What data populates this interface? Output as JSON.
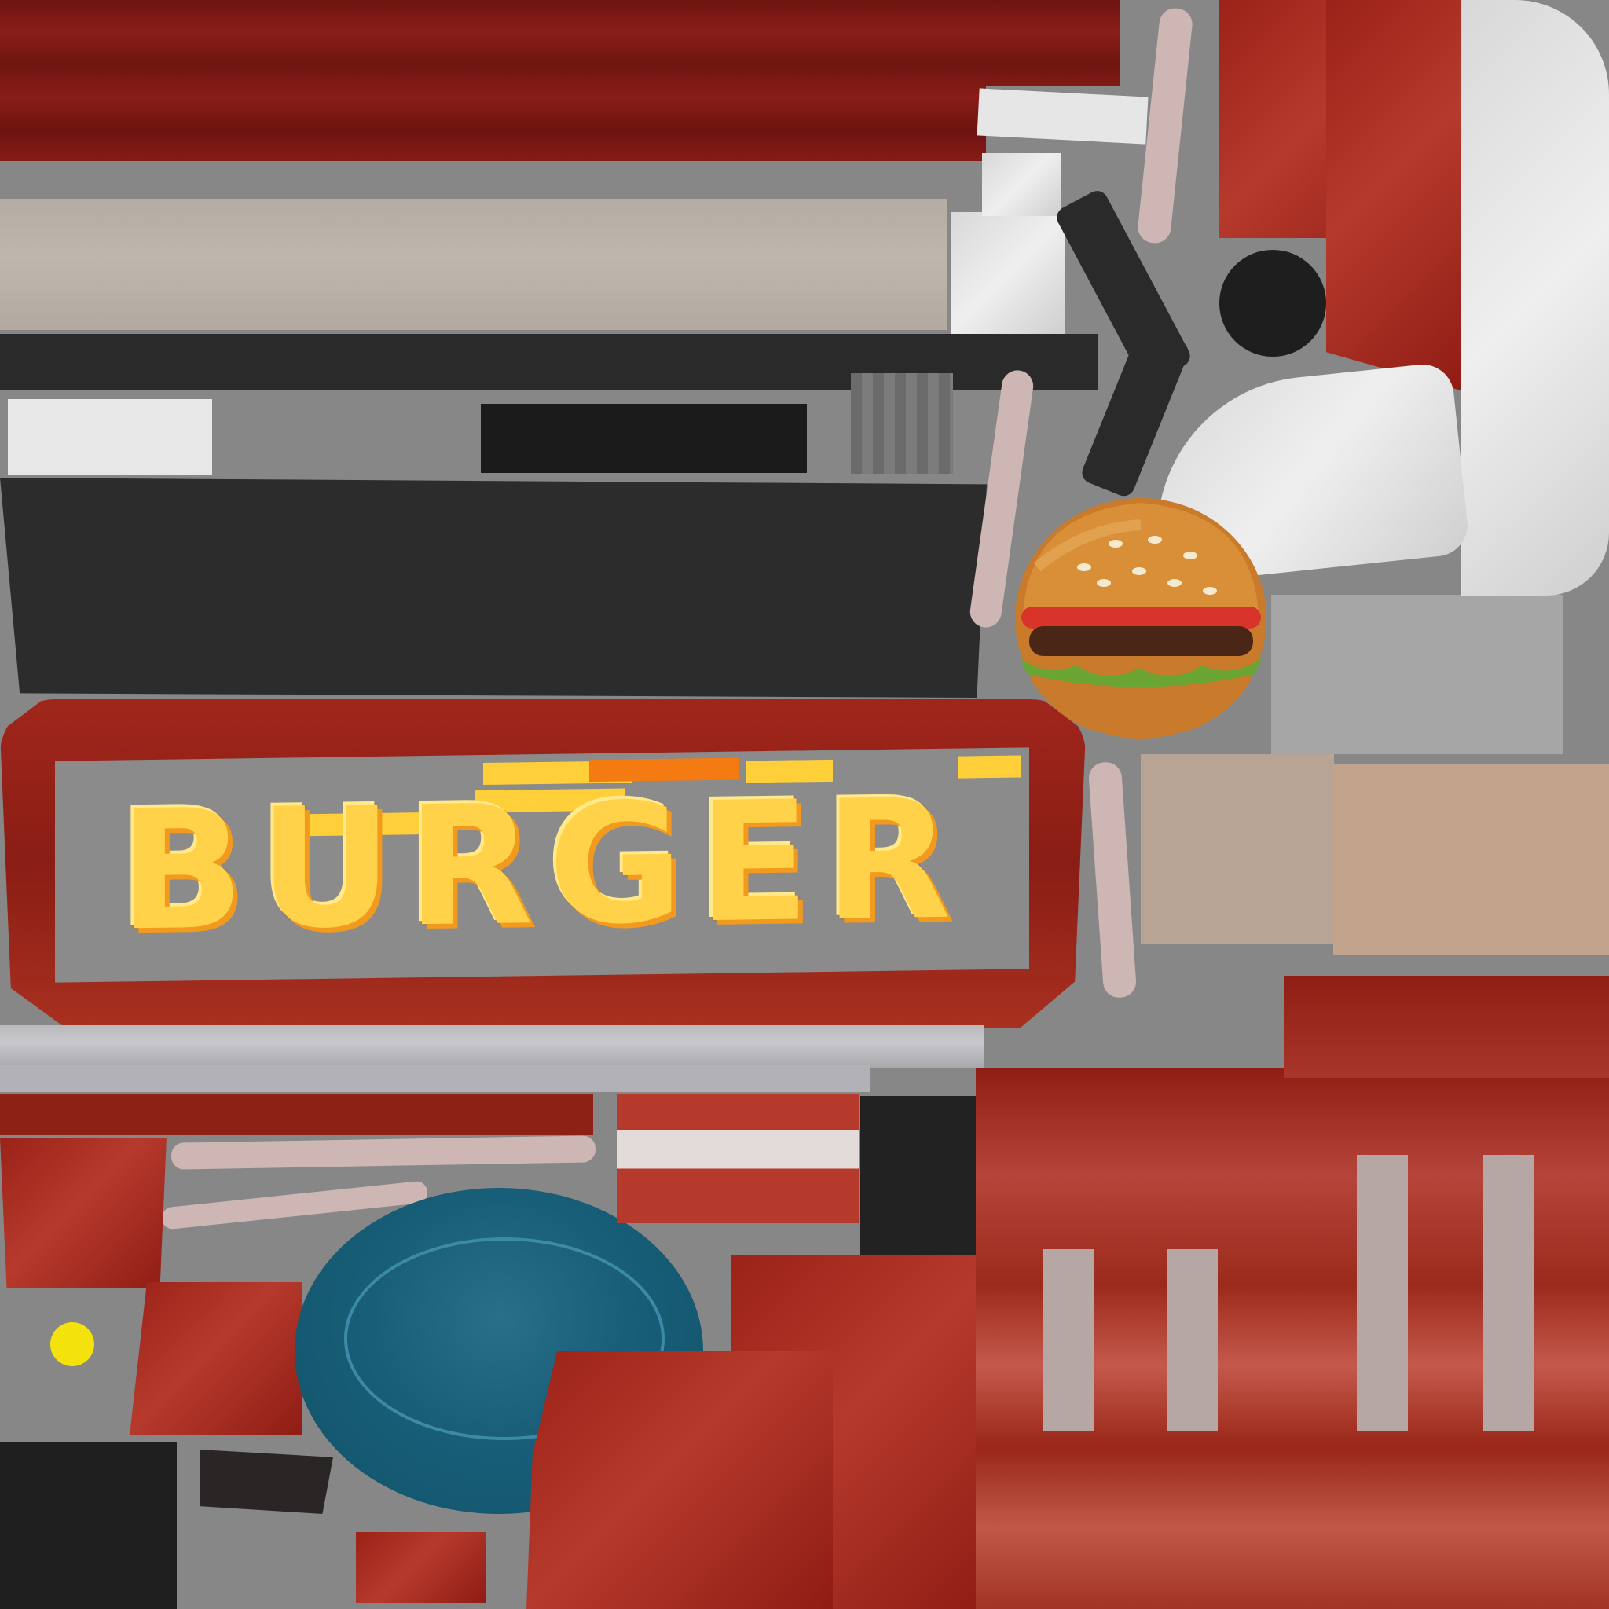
{
  "sign": {
    "text": "BURGER"
  },
  "colors": {
    "background": "#878787",
    "red": "#9b2218",
    "dark": "#2a2a2a",
    "beige": "#bfb6ac",
    "teal": "#185e78",
    "yellow": "#ffd24a",
    "orange": "#f27a18"
  },
  "icons": [
    "burger-icon",
    "yellow-dot",
    "plate-icon"
  ]
}
